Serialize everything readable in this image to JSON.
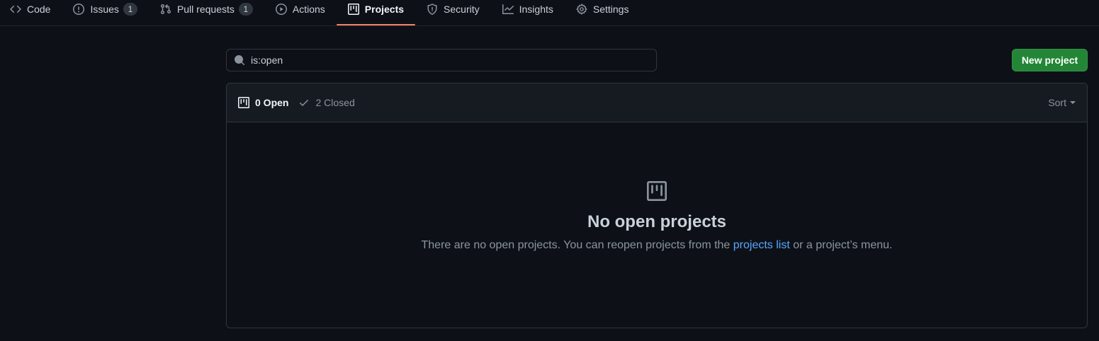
{
  "tabs": [
    {
      "label": "Code",
      "icon": "code-icon"
    },
    {
      "label": "Issues",
      "icon": "issue-opened-icon",
      "count": "1"
    },
    {
      "label": "Pull requests",
      "icon": "git-pull-request-icon",
      "count": "1"
    },
    {
      "label": "Actions",
      "icon": "play-icon"
    },
    {
      "label": "Projects",
      "icon": "project-icon",
      "selected": true
    },
    {
      "label": "Security",
      "icon": "shield-icon"
    },
    {
      "label": "Insights",
      "icon": "graph-icon"
    },
    {
      "label": "Settings",
      "icon": "gear-icon"
    }
  ],
  "search": {
    "value": "is:open",
    "icon": "search-icon"
  },
  "new_project_label": "New project",
  "filters": {
    "open_label": "0 Open",
    "closed_label": "2 Closed"
  },
  "sort_label": "Sort",
  "empty": {
    "icon": "project-icon",
    "title": "No open projects",
    "text_before": "There are no open projects. You can reopen projects from the ",
    "link": "projects list",
    "text_after": " or a project’s menu."
  },
  "colors": {
    "background": "#0d1117",
    "header_bg": "#161b22",
    "border": "#30363d",
    "accent_underline": "#f78166",
    "primary_button": "#238636",
    "link": "#58a6ff"
  }
}
